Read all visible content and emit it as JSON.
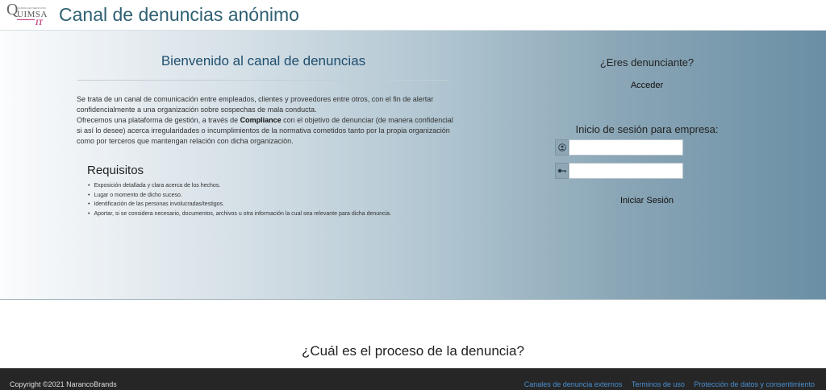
{
  "header": {
    "logo_letter": "Q",
    "logo_word": "UIMSA",
    "logo_small": "QUÍMICA EN SERVICIOS",
    "logo_suffix": "IT",
    "title": "Canal de denuncias anónimo"
  },
  "hero": {
    "welcome_title": "Bienvenido al canal de denuncias",
    "description": {
      "part1": "Se trata de un canal de comunicación entre empleados, clientes y proveedores entre otros, con el fin de alertar confidencialmente a una organización sobre sospechas de mala conducta.",
      "part2_prefix": "Ofrecemos una plataforma de gestión, a través de ",
      "part2_bold": "Compliance",
      "part2_suffix": " con el objetivo de denunciar (de manera confidencial si así lo desee) acerca irregularidades o incumplimientos de la normativa cometidos tanto por la propia organización como por terceros que mantengan relación con dicha organización."
    },
    "requirements_title": "Requisitos",
    "requirements": [
      "Exposición detallada y clara acerca de los hechos.",
      "Lugar o momento de dicho suceso.",
      "Identificación de las personas involucradas/testigos.",
      "Aportar, si se considera necesario, documentos, archivos u otra información la cual sea relevante para dicha denuncia."
    ],
    "denunciante_question": "¿Eres denunciante?",
    "access_label": "Acceder",
    "company_login_title": "Inicio de sesión para empresa:",
    "user_value": "",
    "password_value": "",
    "login_label": "Iniciar Sesión",
    "icons": {
      "user": "user-circle-icon",
      "password": "key-icon"
    }
  },
  "process": {
    "title": "¿Cuál es el proceso de la denuncia?"
  },
  "footer": {
    "copyright": "Copyright ©2021 NarancoBrands",
    "links": [
      "Canales de denuncia externos",
      "Terminos de uso",
      "Protección de datos y consentimiento"
    ]
  },
  "colors": {
    "title": "#2f6073",
    "welcome": "#1f4e6e",
    "gradient_start": "#fbfcfd",
    "gradient_end": "#6a8fa5",
    "footer_bg": "#262626",
    "footer_link": "#4a8fd0",
    "logo_accent": "#c83c7a"
  }
}
